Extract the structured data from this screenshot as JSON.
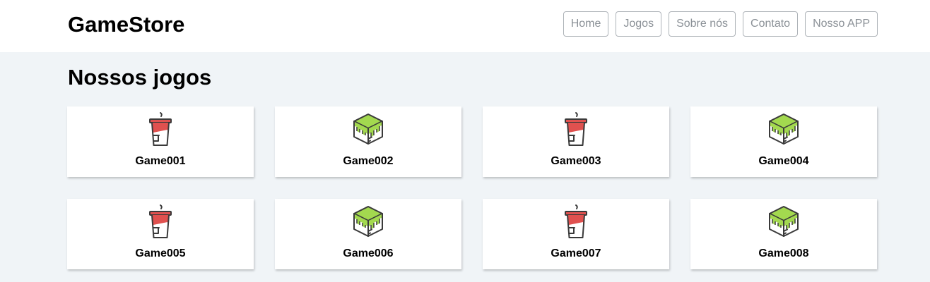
{
  "app": {
    "brand": "GameStore"
  },
  "nav": {
    "items": [
      {
        "label": "Home"
      },
      {
        "label": "Jogos"
      },
      {
        "label": "Sobre nós"
      },
      {
        "label": "Contato"
      },
      {
        "label": "Nosso APP"
      }
    ]
  },
  "main": {
    "title": "Nossos jogos",
    "games": [
      {
        "name": "Game001",
        "icon": "soda-cup-icon"
      },
      {
        "name": "Game002",
        "icon": "green-cube-icon"
      },
      {
        "name": "Game003",
        "icon": "soda-cup-icon"
      },
      {
        "name": "Game004",
        "icon": "green-cube-icon"
      },
      {
        "name": "Game005",
        "icon": "soda-cup-icon"
      },
      {
        "name": "Game006",
        "icon": "green-cube-icon"
      },
      {
        "name": "Game007",
        "icon": "soda-cup-icon"
      },
      {
        "name": "Game008",
        "icon": "green-cube-icon"
      }
    ]
  },
  "colors": {
    "page_background": "#f0f4f7",
    "header_background": "#ffffff",
    "nav_border": "#aeb3b8",
    "nav_text": "#8b9197",
    "cup_red": "#e0514f",
    "cube_green": "#a3d94f",
    "icon_outline": "#3a3a3a"
  }
}
